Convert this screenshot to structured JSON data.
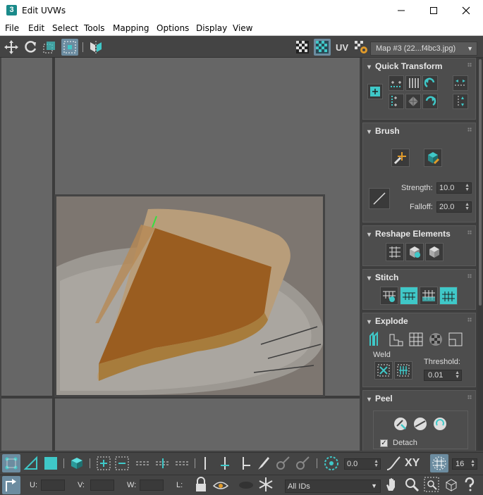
{
  "window": {
    "title": "Edit UVWs",
    "app_badge": "3"
  },
  "menu": [
    "File",
    "Edit",
    "Select",
    "Tools",
    "Mapping",
    "Options",
    "Display",
    "View"
  ],
  "toolbar": {
    "uv_label": "UV",
    "map_select": "Map #3 (22...f4bc3.jpg)"
  },
  "panels": {
    "quick_transform": "Quick Transform",
    "brush": {
      "title": "Brush",
      "strength_label": "Strength:",
      "strength": "10.0",
      "falloff_label": "Falloff:",
      "falloff": "20.0"
    },
    "reshape": "Reshape Elements",
    "stitch": "Stitch",
    "explode": {
      "title": "Explode",
      "weld_label": "Weld",
      "threshold_label": "Threshold:",
      "threshold": "0.01"
    },
    "peel": {
      "title": "Peel",
      "detach_label": "Detach",
      "detach_checked": true
    }
  },
  "bottom": {
    "angle_value": "0.0",
    "xy_label": "XY",
    "grid_value": "16",
    "u_label": "U:",
    "v_label": "V:",
    "w_label": "W:",
    "l_label": "L:",
    "ids_select": "All IDs"
  },
  "colors": {
    "accent": "#3fc8c8",
    "highlight": "#6c8ca0",
    "panel": "#4d4d4d"
  }
}
